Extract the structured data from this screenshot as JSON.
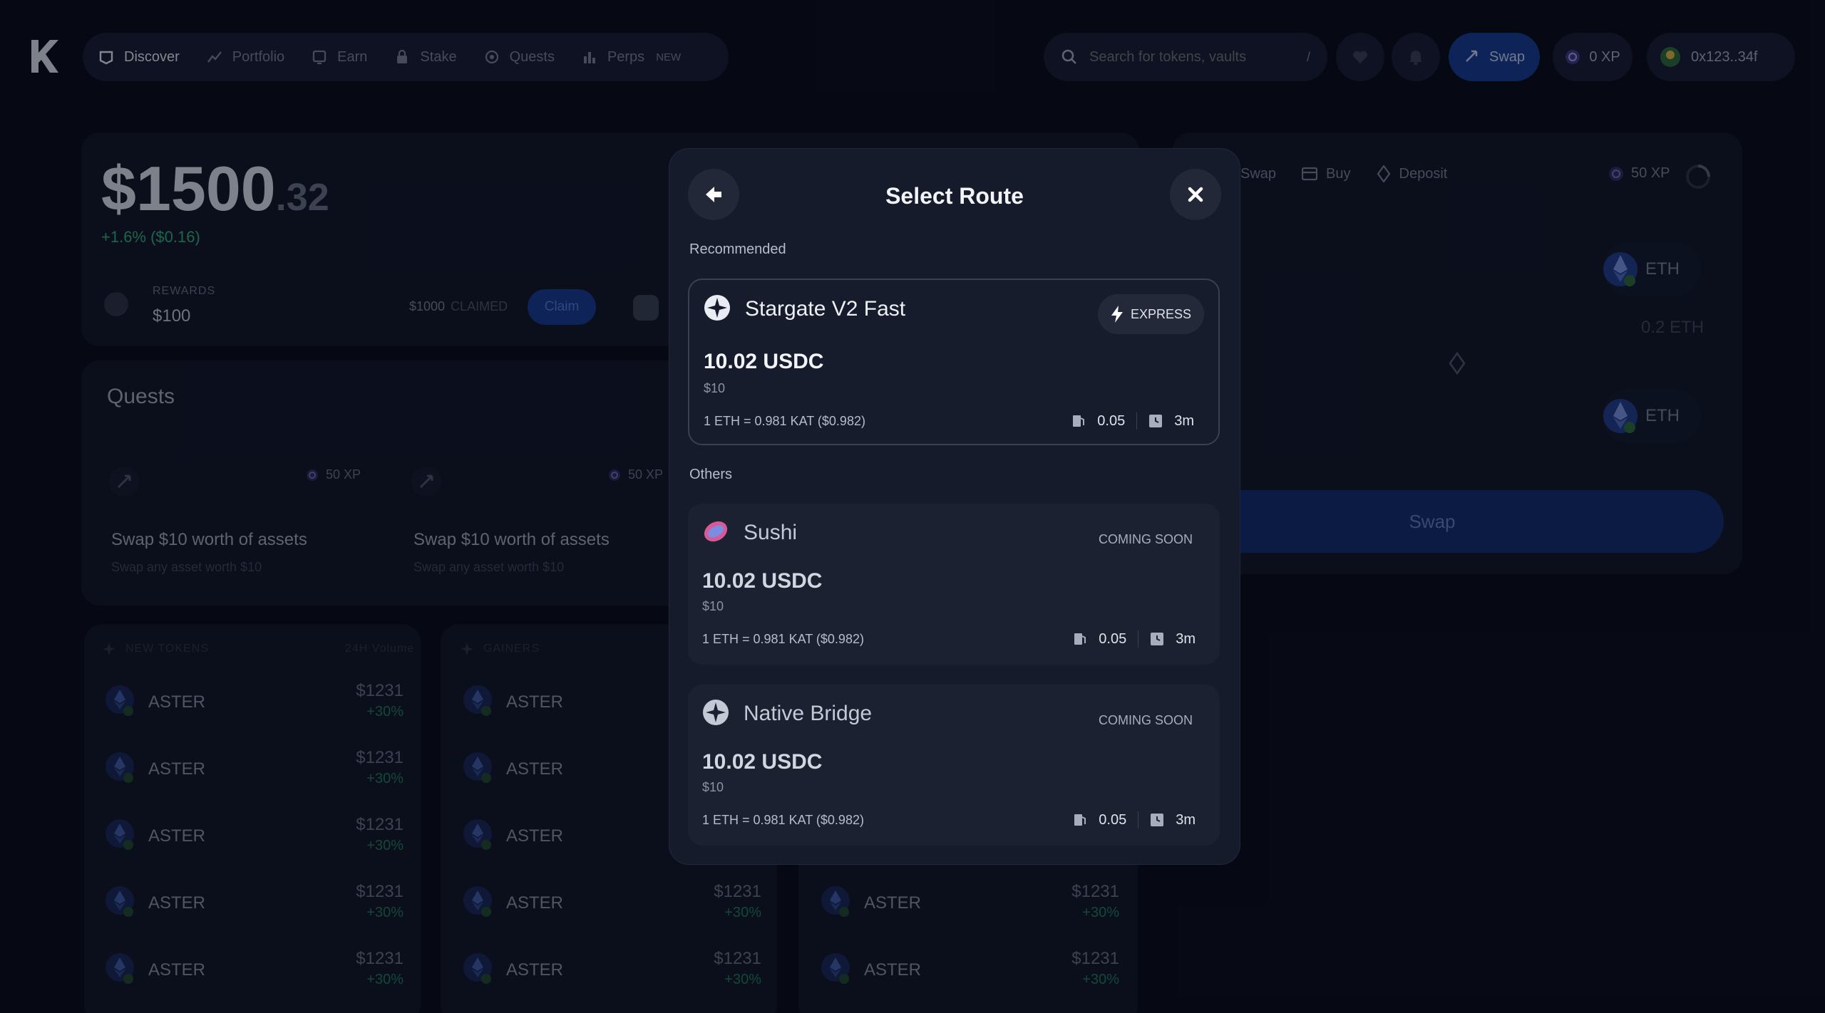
{
  "nav": {
    "items": [
      {
        "label": "Discover",
        "icon": "discover-icon",
        "active": true
      },
      {
        "label": "Portfolio",
        "icon": "chart-line-icon",
        "active": false
      },
      {
        "label": "Earn",
        "icon": "earn-icon",
        "active": false
      },
      {
        "label": "Stake",
        "icon": "lock-icon",
        "active": false
      },
      {
        "label": "Quests",
        "icon": "quests-icon",
        "active": false
      },
      {
        "label": "Perps",
        "icon": "bars-icon",
        "active": false
      }
    ],
    "perps_badge": "NEW",
    "search_placeholder": "Search for tokens, vaults",
    "search_shortcut": "/",
    "swap_label": "Swap",
    "xp_label": "0 XP",
    "wallet_address": "0x123..34f"
  },
  "portfolio": {
    "balance_whole": "$1500",
    "balance_cents": ".32",
    "change": "+1.6% ($0.16)",
    "rewards_label": "REWARDS",
    "rewards_value": "$100",
    "claimed_amount": "$1000",
    "claimed_label": "CLAIMED",
    "claim_button": "Claim"
  },
  "quests": {
    "title": "Quests",
    "cards": [
      {
        "xp": "50 XP",
        "title": "Swap $10 worth of assets",
        "subtitle": "Swap any asset worth $10"
      },
      {
        "xp": "50 XP",
        "title": "Swap $10 worth of assets",
        "subtitle": "Swap any asset worth $10"
      }
    ]
  },
  "lists": [
    {
      "title": "NEW TOKENS",
      "volume_label": "24H Volume",
      "rows": [
        {
          "name": "ASTER",
          "price": "$1231",
          "change": "+30%"
        },
        {
          "name": "ASTER",
          "price": "$1231",
          "change": "+30%"
        },
        {
          "name": "ASTER",
          "price": "$1231",
          "change": "+30%"
        },
        {
          "name": "ASTER",
          "price": "$1231",
          "change": "+30%"
        },
        {
          "name": "ASTER",
          "price": "$1231",
          "change": "+30%"
        }
      ]
    },
    {
      "title": "GAINERS",
      "rows": [
        {
          "name": "ASTER",
          "price": "",
          "change": ""
        },
        {
          "name": "ASTER",
          "price": "",
          "change": ""
        },
        {
          "name": "ASTER",
          "price": "",
          "change": ""
        },
        {
          "name": "ASTER",
          "price": "$1231",
          "change": "+30%"
        },
        {
          "name": "ASTER",
          "price": "$1231",
          "change": "+30%"
        }
      ]
    },
    {
      "title": "",
      "rows": [
        {
          "name": "ASTER",
          "price": "$1231",
          "change": "+30%"
        },
        {
          "name": "ASTER",
          "price": "$1231",
          "change": "+30%"
        }
      ]
    }
  ],
  "swap_panel": {
    "tabs": [
      "Swap",
      "Buy",
      "Deposit"
    ],
    "xp": "50 XP",
    "from_token": "ETH",
    "from_amount": "0.2 ETH",
    "to_token": "ETH",
    "button": "Swap"
  },
  "modal": {
    "title": "Select Route",
    "recommended_label": "Recommended",
    "others_label": "Others",
    "routes": [
      {
        "name": "Stargate V2 Fast",
        "tag": "EXPRESS",
        "amount": "10.02 USDC",
        "usd": "$10",
        "rate": "1 ETH = 0.981 KAT ($0.982)",
        "gas": "0.05",
        "time": "3m"
      },
      {
        "name": "Sushi",
        "tag": "COMING SOON",
        "amount": "10.02 USDC",
        "usd": "$10",
        "rate": "1 ETH = 0.981 KAT ($0.982)",
        "gas": "0.05",
        "time": "3m"
      },
      {
        "name": "Native Bridge",
        "tag": "COMING SOON",
        "amount": "10.02 USDC",
        "usd": "$10",
        "rate": "1 ETH = 0.981 KAT ($0.982)",
        "gas": "0.05",
        "time": "3m"
      }
    ]
  },
  "colors": {
    "background": "#070a14",
    "panel": "#0f1424",
    "modal": "#161b2b",
    "accent_blue": "#143a8f",
    "positive": "#2fb37a"
  }
}
